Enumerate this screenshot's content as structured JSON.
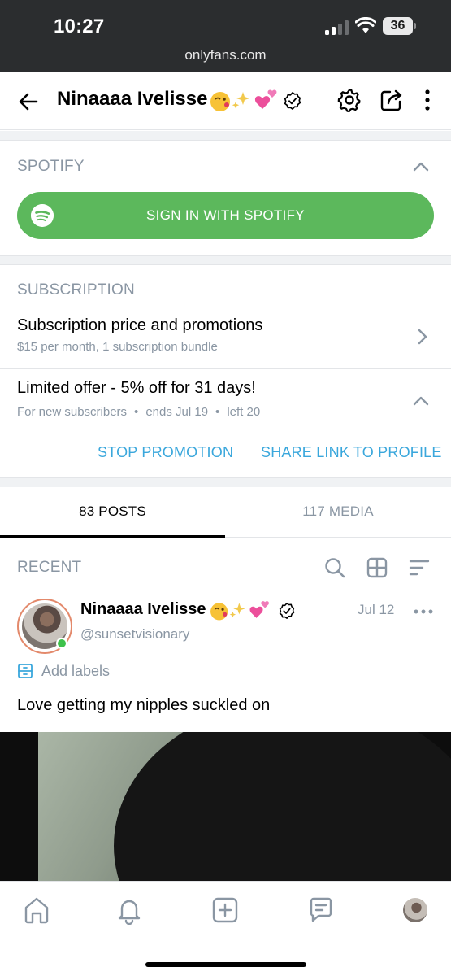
{
  "status_bar": {
    "time": "10:27",
    "battery": "36",
    "url": "onlyfans.com"
  },
  "header": {
    "name": "Ninaaaa Ivelisse",
    "emojis": [
      "face-blowing-kiss",
      "sparkles",
      "two-hearts"
    ]
  },
  "spotify": {
    "title": "SPOTIFY",
    "button_label": "SIGN IN WITH SPOTIFY"
  },
  "subscription": {
    "title": "SUBSCRIPTION",
    "price_title": "Subscription price and promotions",
    "price_sub": "$15 per month, 1 subscription bundle",
    "offer_title": "Limited offer - 5% off for 31 days!",
    "offer_details": [
      "For new subscribers",
      "ends Jul 19",
      "left 20"
    ],
    "stop_promotion": "STOP PROMOTION",
    "share_link": "SHARE LINK TO PROFILE"
  },
  "tabs": [
    {
      "label": "83 POSTS",
      "active": true
    },
    {
      "label": "117 MEDIA",
      "active": false
    }
  ],
  "recent": {
    "title": "RECENT"
  },
  "post": {
    "author": "Ninaaaa Ivelisse",
    "handle": "@sunsetvisionary",
    "date": "Jul 12",
    "add_labels": "Add labels",
    "text": "Love getting my nipples suckled on"
  },
  "colors": {
    "accent": "#3aa7dc",
    "spotify_green": "#5cb85c",
    "muted": "#8a96a3",
    "online": "#3ec14b"
  }
}
